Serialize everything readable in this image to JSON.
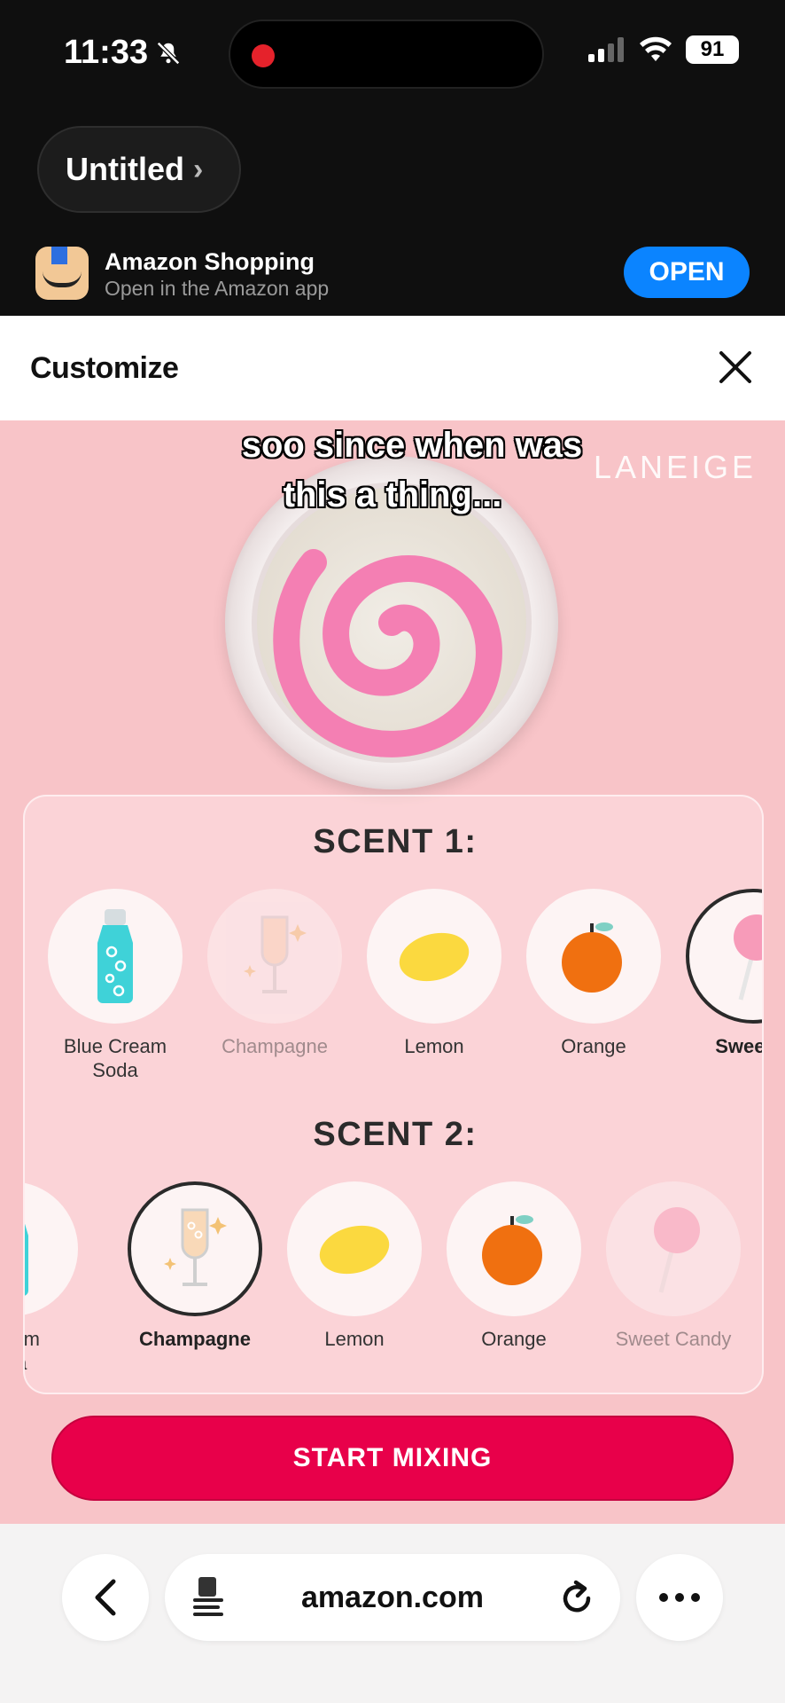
{
  "status_bar": {
    "time": "11:33",
    "battery": "91",
    "icons": [
      "bell-slash-icon",
      "signal-icon",
      "wifi-icon",
      "battery-icon"
    ]
  },
  "title_pill": {
    "label": "Untitled",
    "chevron": "›"
  },
  "app_banner": {
    "title": "Amazon Shopping",
    "subtitle": "Open in the Amazon app",
    "open_label": "OPEN"
  },
  "customize": {
    "title": "Customize",
    "close_icon": "close-icon"
  },
  "overlay_caption": {
    "line1": "soo since when was",
    "line2": "this a thing..."
  },
  "brand": "LANEIGE",
  "scent1": {
    "title": "SCENT 1:",
    "items": [
      {
        "label": "Blue Cream Soda",
        "icon": "soda-bottle-icon",
        "state": "normal"
      },
      {
        "label": "Champagne",
        "icon": "champagne-glass-icon",
        "state": "dim"
      },
      {
        "label": "Lemon",
        "icon": "lemon-icon",
        "state": "normal"
      },
      {
        "label": "Orange",
        "icon": "orange-icon",
        "state": "normal"
      },
      {
        "label": "Sweet C",
        "icon": "lollipop-icon",
        "state": "selected"
      }
    ]
  },
  "scent2": {
    "title": "SCENT 2:",
    "items": [
      {
        "label": "Cream\noda",
        "icon": "soda-bottle-icon",
        "state": "normal"
      },
      {
        "label": "Champagne",
        "icon": "champagne-glass-icon",
        "state": "selected"
      },
      {
        "label": "Lemon",
        "icon": "lemon-icon",
        "state": "normal"
      },
      {
        "label": "Orange",
        "icon": "orange-icon",
        "state": "normal"
      },
      {
        "label": "Sweet Candy",
        "icon": "lollipop-icon",
        "state": "dim"
      }
    ]
  },
  "cta": {
    "label": "START MIXING"
  },
  "browser": {
    "url": "amazon.com"
  },
  "colors": {
    "accent": "#e8004a",
    "page_pink": "#f8c4c8",
    "open_blue": "#0b84ff",
    "swirl_pink": "#f47fb3"
  }
}
